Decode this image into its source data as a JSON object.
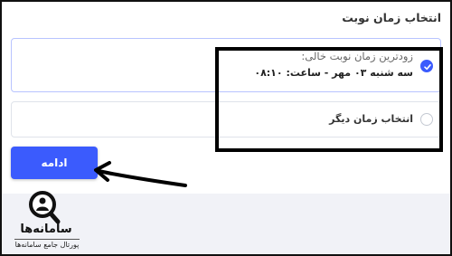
{
  "page": {
    "title": "انتخاب زمان نوبت"
  },
  "options": [
    {
      "line1": "زودترین زمان نوبت خالی:",
      "line2": "سه شنبه ۰۳ مهر - ساعت: ۰۸:۱۰",
      "selected": true
    },
    {
      "label": "انتخاب زمان دیگر",
      "selected": false
    }
  ],
  "actions": {
    "continue_label": "ادامه"
  },
  "logo": {
    "brand": "سامانه‌ها",
    "tagline": "پورتال جامع سامانه‌ها"
  },
  "colors": {
    "accent": "#3b5bfd",
    "footer_bg": "#f1f2f7",
    "highlight": "#000000"
  },
  "icons": {
    "selected_radio": "check-icon",
    "annotation": "arrow-left-icon",
    "logo": "magnifier-person-icon"
  }
}
